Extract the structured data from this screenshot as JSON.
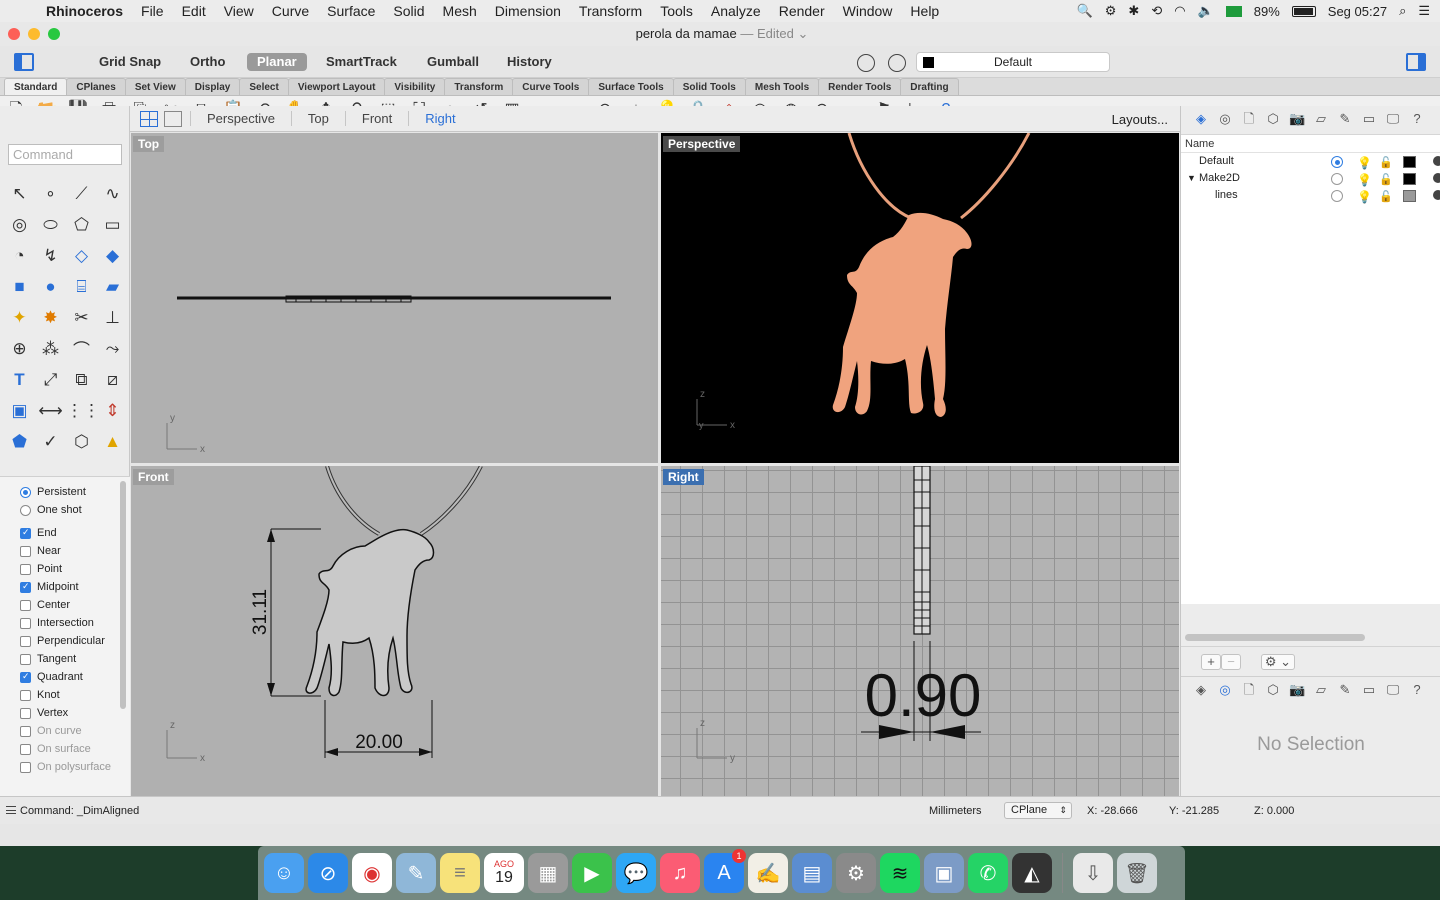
{
  "menubar": {
    "app": "Rhinoceros",
    "items": [
      "File",
      "Edit",
      "View",
      "Curve",
      "Surface",
      "Solid",
      "Mesh",
      "Dimension",
      "Transform",
      "Tools",
      "Analyze",
      "Render",
      "Window",
      "Help"
    ],
    "battery": "89%",
    "clock": "Seg 05:27"
  },
  "window": {
    "title": "perola da mamae",
    "edited": "— Edited"
  },
  "toggles": [
    "Grid Snap",
    "Ortho",
    "Planar",
    "SmartTrack",
    "Gumball",
    "History"
  ],
  "active_toggle": "Planar",
  "layer_selector": "Default",
  "tabs": [
    "Standard",
    "CPlanes",
    "Set View",
    "Display",
    "Select",
    "Viewport Layout",
    "Visibility",
    "Transform",
    "Curve Tools",
    "Surface Tools",
    "Solid Tools",
    "Mesh Tools",
    "Render Tools",
    "Drafting"
  ],
  "command": {
    "placeholder": "Command"
  },
  "viewport_tabs": [
    "Perspective",
    "Top",
    "Front",
    "Right"
  ],
  "active_viewport_tab": "Right",
  "layouts_label": "Layouts...",
  "viewports": {
    "top": "Top",
    "perspective": "Perspective",
    "front": "Front",
    "right": "Right"
  },
  "dimensions": {
    "height": "31.11",
    "width": "20.00",
    "thickness": "0.90"
  },
  "osnap": {
    "modes": [
      "Persistent",
      "One shot"
    ],
    "items": [
      {
        "label": "End",
        "checked": true
      },
      {
        "label": "Near",
        "checked": false
      },
      {
        "label": "Point",
        "checked": false
      },
      {
        "label": "Midpoint",
        "checked": true
      },
      {
        "label": "Center",
        "checked": false
      },
      {
        "label": "Intersection",
        "checked": false
      },
      {
        "label": "Perpendicular",
        "checked": false
      },
      {
        "label": "Tangent",
        "checked": false
      },
      {
        "label": "Quadrant",
        "checked": true
      },
      {
        "label": "Knot",
        "checked": false
      },
      {
        "label": "Vertex",
        "checked": false
      },
      {
        "label": "On curve",
        "checked": false
      },
      {
        "label": "On surface",
        "checked": false
      },
      {
        "label": "On polysurface",
        "checked": false
      }
    ]
  },
  "layers": {
    "header": "Name",
    "rows": [
      {
        "name": "Default",
        "current": true,
        "color": "#000000"
      },
      {
        "name": "Make2D",
        "current": false,
        "color": "#000000"
      },
      {
        "name": "lines",
        "current": false,
        "color": "#9a9a9a"
      }
    ]
  },
  "properties": {
    "empty": "No Selection"
  },
  "status": {
    "command": "Command: _DimAligned",
    "units": "Millimeters",
    "cplane": "CPlane",
    "x": "X: -28.666",
    "y": "Y: -21.285",
    "z": "Z: 0.000"
  },
  "dock": {
    "calendar_month": "AGO",
    "calendar_day": "19",
    "appstore_badge": "1"
  },
  "colors": {
    "accent": "#2a6fd6",
    "pendant": "#f0a37e",
    "viewport_bg": "#b0b0b0"
  }
}
